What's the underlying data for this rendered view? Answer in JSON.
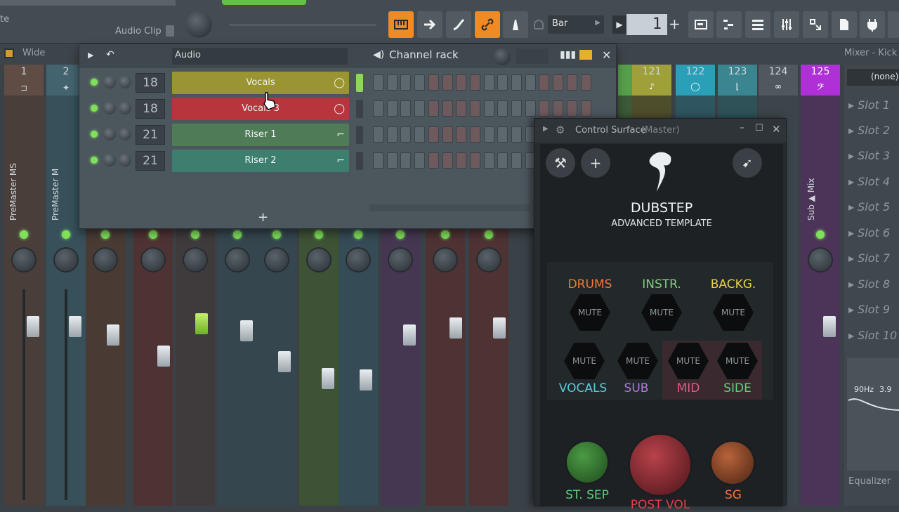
{
  "toolbar": {
    "left_text": "te",
    "audio_clip": "Audio Clip",
    "snap_label": "Bar",
    "pattern_number": "1",
    "plus": "+",
    "accent": "#f08a24"
  },
  "subbar": {
    "wide_label": "Wide",
    "mixer_title": "Mixer - Kick"
  },
  "mixer": {
    "strips_left": [
      {
        "num": "1",
        "label": "PreMaster MS",
        "color": "#5b4a44",
        "headcolor": "#6d5c56",
        "icon": "routing-icon"
      },
      {
        "num": "2",
        "label": "PreMaster M",
        "color": "#3d5560",
        "headcolor": "#4a6a77",
        "icon": "waveform-icon"
      }
    ],
    "strips_right": [
      {
        "num": "121",
        "color": "#7b7a2f",
        "headcolor": "#9fa03a",
        "icon": "note-icon"
      },
      {
        "num": "122",
        "color": "#2f6b79",
        "headcolor": "#2aa0b8",
        "icon": "lips-icon"
      },
      {
        "num": "123",
        "color": "#35636a",
        "headcolor": "#3a8590",
        "icon": "envelope-icon"
      },
      {
        "num": "124",
        "color": "#3f484e",
        "headcolor": "#4e585e",
        "icon": "link-icon"
      },
      {
        "num": "125",
        "color": "#6a2f7a",
        "headcolor": "#b030d8",
        "icon": "bass-clef-icon",
        "label": "Sub ▲ Mix"
      }
    ],
    "none_label": "(none)"
  },
  "rack": {
    "audio_label": "Audio",
    "title": "Channel rack",
    "add": "+",
    "channels": [
      {
        "num": "18",
        "name": "Vocals",
        "color": "#9a9433"
      },
      {
        "num": "18",
        "name": "Vocals 3",
        "color": "#b8353e"
      },
      {
        "num": "21",
        "name": "Riser 1",
        "color": "#4f7b57"
      },
      {
        "num": "21",
        "name": "Riser 2",
        "color": "#3c7f6f"
      }
    ]
  },
  "control_surface": {
    "title": "Control Surface",
    "subtitle": "(Master)",
    "brand": "DUBSTEP",
    "tagline": "ADVANCED TEMPLATE",
    "mute": "MUTE",
    "groups_top": [
      {
        "label": "DRUMS",
        "color": "#f07a3a"
      },
      {
        "label": "INSTR.",
        "color": "#7fd07a"
      },
      {
        "label": "BACKG.",
        "color": "#e6d04a"
      }
    ],
    "groups_bottom": [
      {
        "label": "VOCALS",
        "color": "#5ec9d8"
      },
      {
        "label": "SUB",
        "color": "#b07ae0"
      },
      {
        "label": "MID",
        "color": "#e05a8a"
      },
      {
        "label": "SIDE",
        "color": "#5ed07a"
      }
    ],
    "knobs": [
      {
        "label": "ST. SEP",
        "color": "#5ed07a"
      },
      {
        "label": "POST VOL",
        "color": "#e0404a"
      },
      {
        "label": "SG",
        "color": "#f07a3a"
      }
    ]
  },
  "slots": [
    "Slot 1",
    "Slot 2",
    "Slot 3",
    "Slot 4",
    "Slot 5",
    "Slot 6",
    "Slot 7",
    "Slot 8",
    "Slot 9",
    "Slot 10"
  ],
  "eq": {
    "freq": "90Hz",
    "val": "3.9",
    "label": "Equalizer"
  }
}
